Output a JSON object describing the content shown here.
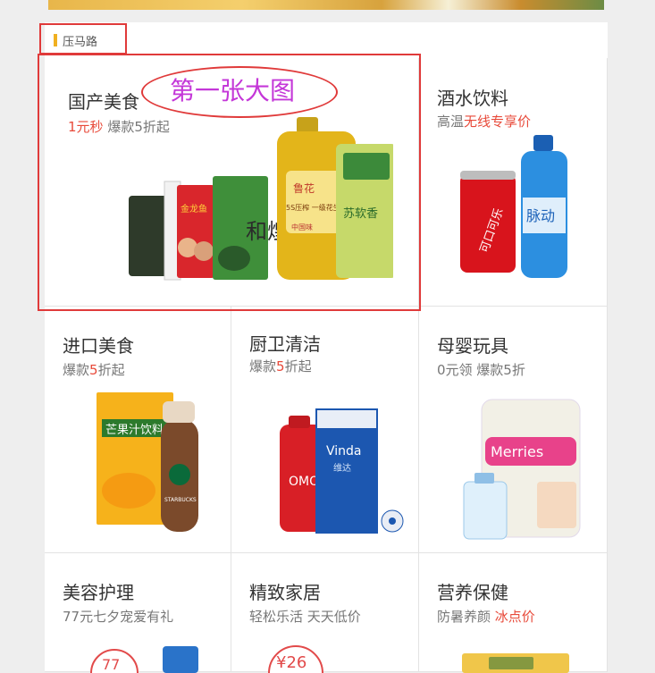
{
  "section": {
    "title": "压马路"
  },
  "annotation": {
    "text": "第一张大图"
  },
  "tiles": [
    {
      "title": "国产美食",
      "sub_hl": "1元秒",
      "sub_rest": " 爆款5折起"
    },
    {
      "title": "酒水饮料",
      "sub_pre": "高温",
      "sub_hl": "无线专享价"
    },
    {
      "title": "进口美食",
      "sub_pre": "爆款",
      "sub_hl": "5",
      "sub_post": "折起"
    },
    {
      "title": "厨卫清洁",
      "sub_pre": "爆款",
      "sub_hl": "5",
      "sub_post": "折起"
    },
    {
      "title": "母婴玩具",
      "sub": "0元领 爆款5折"
    },
    {
      "title": "美容护理",
      "sub": "77元七夕宠爱有礼"
    },
    {
      "title": "精致家居",
      "sub": "轻松乐活 天天低价"
    },
    {
      "title": "营养保健",
      "sub_pre": "防暑养颜 ",
      "sub_hl": "冰点价"
    }
  ],
  "product_text": {
    "chips_brand": "金龙鱼",
    "oil_brand": "鲁花",
    "oil_label": "5S压榨 一级花生油",
    "oil_sub": "中国味",
    "rice_label": "苏软香",
    "pack_label": "和煌",
    "cola_text": "可口可乐",
    "sport_text": "脉动",
    "juice_text": "芒果汁饮料",
    "drink_brand": "STARBUCKS",
    "tissue_brand": "Vinda",
    "tissue_sub": "维达",
    "detergent_brand": "OMO",
    "diaper_brand": "Merries",
    "price_77": "77",
    "price_26": "¥26"
  },
  "colors": {
    "accent_red": "#e84a3a",
    "tab_bar": "#f0b020",
    "annotation_purple": "#c437d8"
  }
}
